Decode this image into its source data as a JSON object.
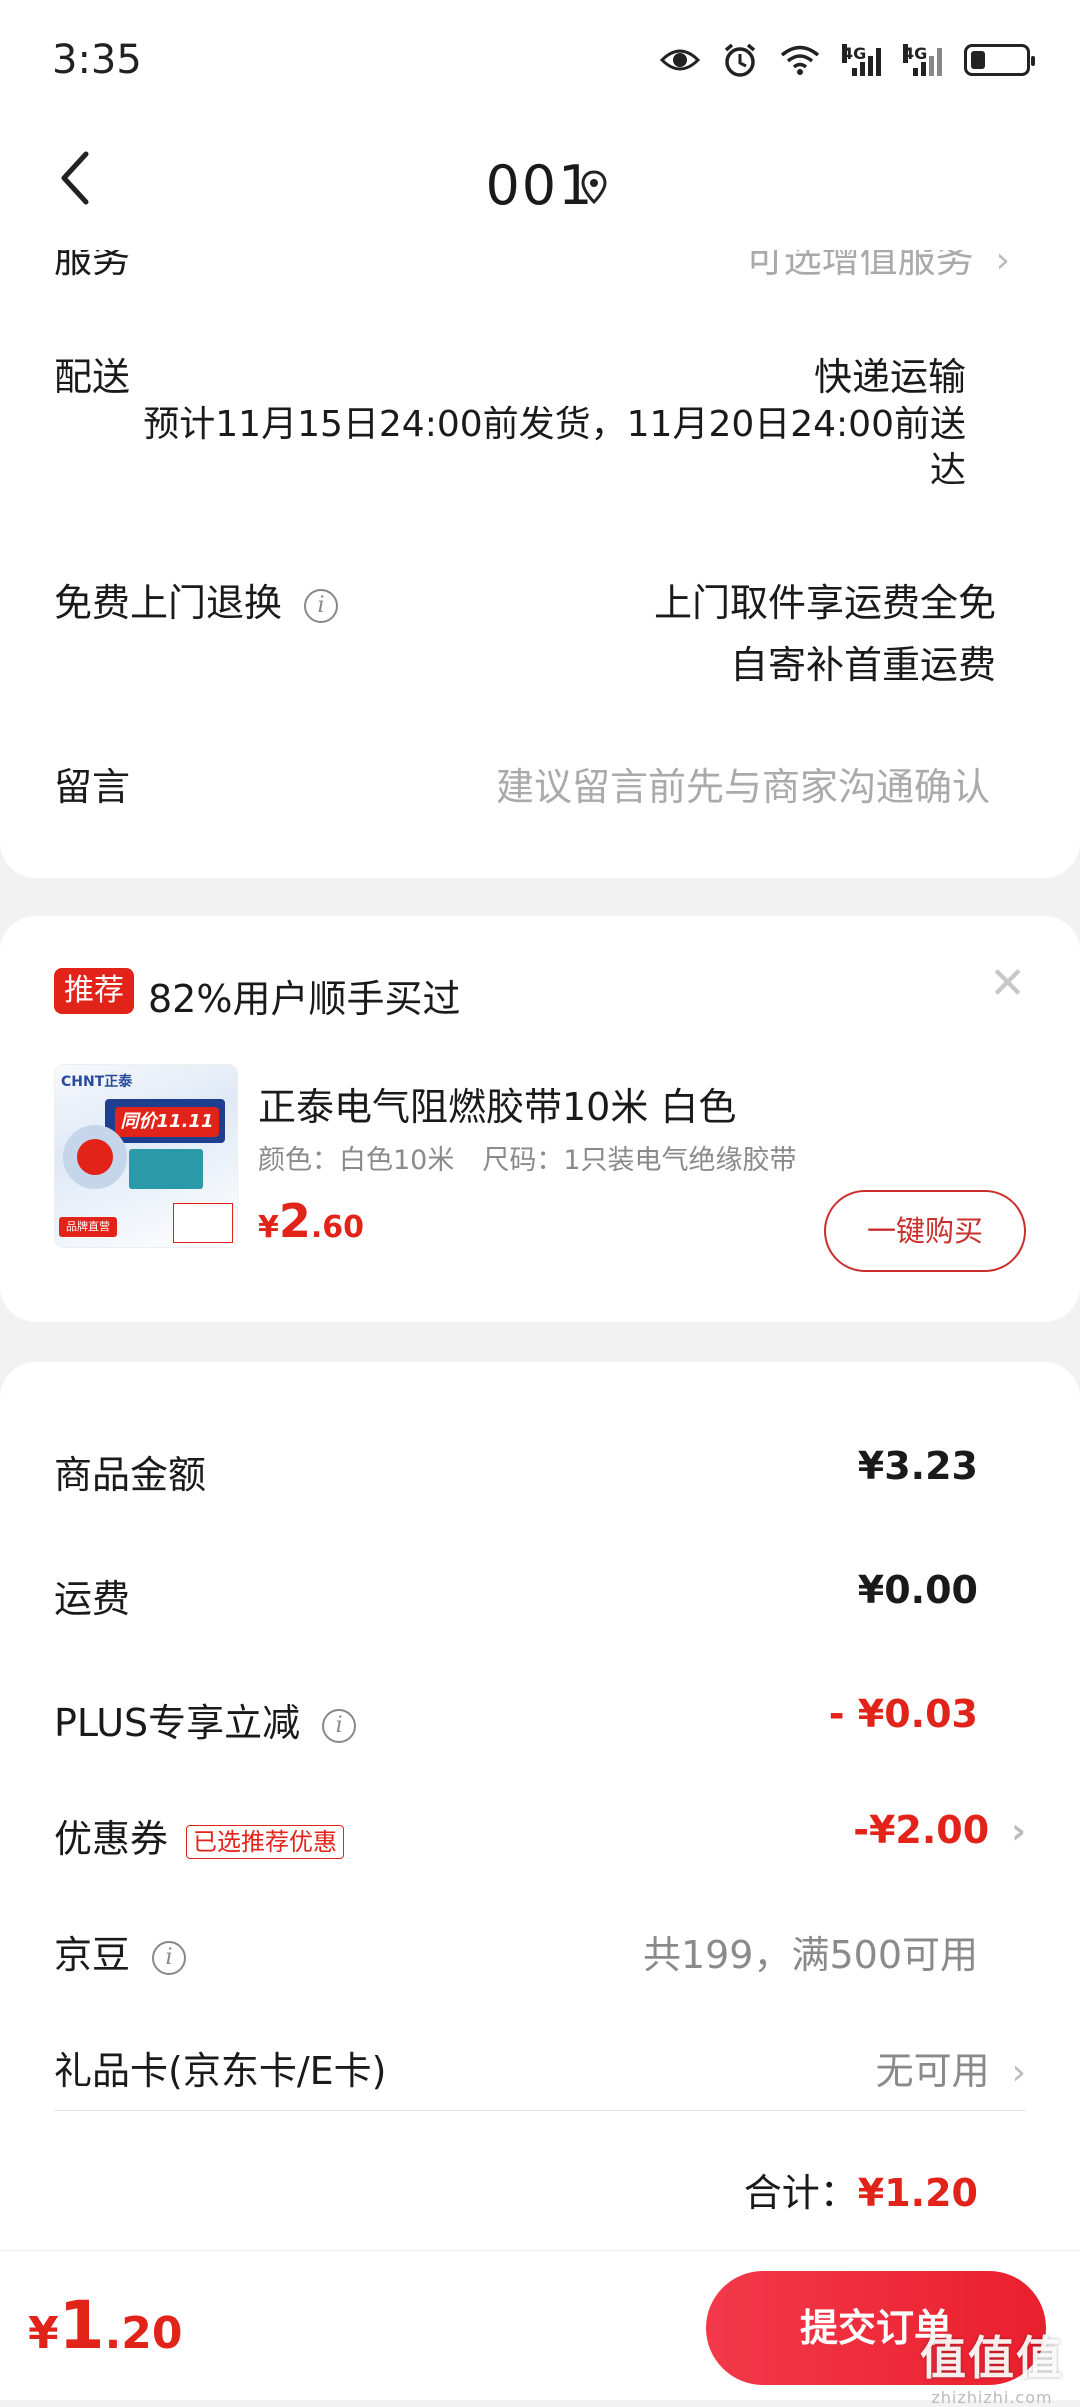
{
  "status_bar": {
    "time": "3:35",
    "icons": [
      "eye-icon",
      "alarm-icon",
      "wifi-icon",
      "signal-4g-icon",
      "signal-4g-icon",
      "battery-icon"
    ],
    "network_label_1": "4G",
    "network_label_2": "4G",
    "battery_level": 0.25
  },
  "nav": {
    "back_icon": "chevron-left-icon",
    "title": "001",
    "location_icon": "location-pin-icon"
  },
  "shipping": {
    "partial_label": "服务",
    "partial_value": "可选增值服务",
    "delivery_label": "配送",
    "delivery_method": "快递运输",
    "delivery_estimate_line1": "预计11月15日24:00前发货，11月20日24:00前送",
    "delivery_estimate_line2": "达",
    "return_label": "免费上门退换",
    "return_value_line1": "上门取件享运费全免",
    "return_value_line2": "自寄补首重运费",
    "message_label": "留言",
    "message_placeholder": "建议留言前先与商家沟通确认"
  },
  "recommend": {
    "tag": "推荐",
    "title": "82%用户顺手买过",
    "close_icon": "close-icon",
    "product": {
      "image_brand": "CHNT正泰",
      "image_promo": "同价11.11",
      "image_badge": "品牌直营",
      "name": "正泰电气阻燃胶带10米 白色",
      "spec_color": "颜色：白色10米",
      "spec_size": "尺码：1只装电气绝缘胶带",
      "price_symbol": "¥",
      "price_int": "2",
      "price_dec": ".60",
      "buy_button": "一键购买"
    }
  },
  "summary": {
    "goods_label": "商品金额",
    "goods_value": "¥3.23",
    "freight_label": "运费",
    "freight_value": "¥0.00",
    "plus_label": "PLUS专享立减",
    "plus_value": "- ¥0.03",
    "coupon_label": "优惠券",
    "coupon_tag": "已选推荐优惠",
    "coupon_value": "-¥2.00",
    "jingdou_label": "京豆",
    "jingdou_value": "共199，满500可用",
    "giftcard_label": "礼品卡(京东卡/E卡)",
    "giftcard_value": "无可用",
    "total_label": "合计：",
    "total_value": "¥1.20"
  },
  "bottom": {
    "price_symbol": "¥",
    "price_int": "1",
    "price_dec": ".20",
    "submit_button": "提交订单",
    "watermark_main": "值值值",
    "watermark_sub": "zhizhizhi.com"
  },
  "colors": {
    "accent_red": "#e2231a",
    "button_red": "#ea1f2d",
    "muted_text": "#aaaaaa",
    "background": "#f2f2f2"
  }
}
